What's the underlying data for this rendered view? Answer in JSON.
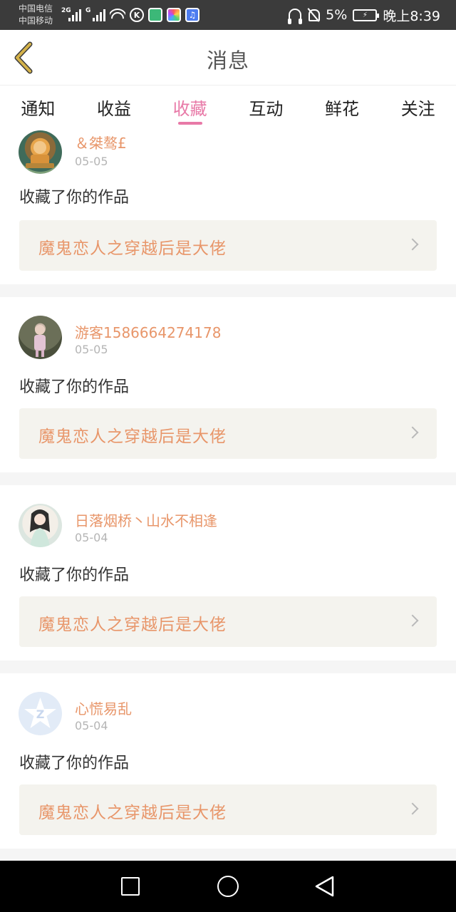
{
  "status_bar": {
    "carrier_1": "中国电信",
    "carrier_2": "中国移动",
    "net_1": "2G",
    "net_2": "G",
    "k_label": "K",
    "music_glyph": "♫",
    "battery_percent": "5%",
    "time": "晚上8:39",
    "icons": [
      "signal-icon",
      "wifi-icon",
      "k-app-icon",
      "green-app-icon",
      "photos-app-icon",
      "music-app-icon",
      "headset-icon",
      "bell-off-icon",
      "battery-icon"
    ]
  },
  "header": {
    "title": "消息",
    "back_icon": "chevron-left-icon",
    "back_color": "#d4b24a"
  },
  "tabs": [
    {
      "label": "通知",
      "active": false
    },
    {
      "label": "收益",
      "active": false
    },
    {
      "label": "收藏",
      "active": true
    },
    {
      "label": "互动",
      "active": false
    },
    {
      "label": "鲜花",
      "active": false
    },
    {
      "label": "关注",
      "active": false
    }
  ],
  "items": [
    {
      "username": "＆桀骜£",
      "date": "05-05",
      "action": "收藏了你的作品",
      "work_title": "魔鬼恋人之穿越后是大佬",
      "avatar": "game-avatar"
    },
    {
      "username": "游客1586664274178",
      "date": "05-05",
      "action": "收藏了你的作品",
      "work_title": "魔鬼恋人之穿越后是大佬",
      "avatar": "photo-avatar"
    },
    {
      "username": "日落烟桥丶山水不相逢",
      "date": "05-04",
      "action": "收藏了你的作品",
      "work_title": "魔鬼恋人之穿越后是大佬",
      "avatar": "anime-girl-avatar"
    },
    {
      "username": "心慌易乱",
      "date": "05-04",
      "action": "收藏了你的作品",
      "work_title": "魔鬼恋人之穿越后是大佬",
      "avatar": "qq-default-avatar"
    }
  ],
  "colors": {
    "accent": "#e879a7",
    "username": "#e8966a",
    "work_title": "#e8966a",
    "work_bg": "#f4f3ee"
  },
  "nav_bar": {
    "icons": [
      "recent-apps-icon",
      "home-icon",
      "back-triangle-icon"
    ]
  }
}
